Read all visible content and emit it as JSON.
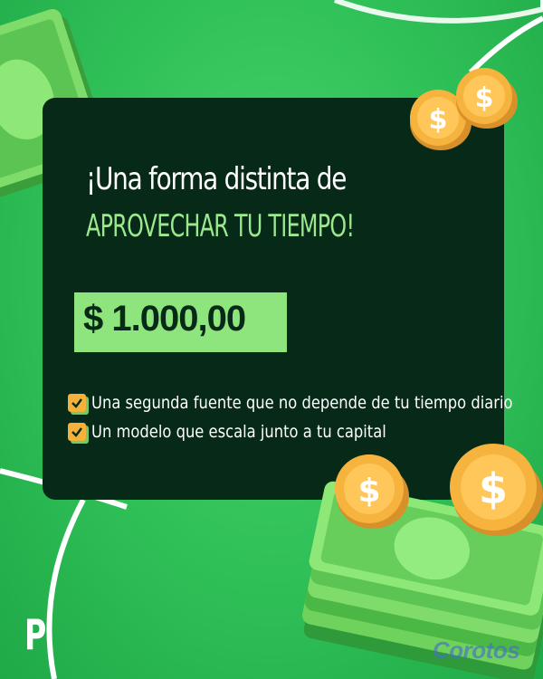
{
  "headline": {
    "line1": "¡Una forma distinta de",
    "line2": "APROVECHAR TU TIEMPO!"
  },
  "price": "$ 1.000,00",
  "bullets": [
    "Una segunda fuente que no depende de tu tiempo diario",
    "Un modelo que escala junto a tu capital"
  ],
  "brand_mark": "P",
  "watermark": "Corotos",
  "colors": {
    "background": "#33c35c",
    "card": "#072a18",
    "accent_green": "#8fe57d",
    "checkbox": "#f4b23c",
    "coin": "#f6b43e"
  },
  "icons": [
    "checkbox-icon",
    "coin-icon",
    "banknote-icon"
  ]
}
